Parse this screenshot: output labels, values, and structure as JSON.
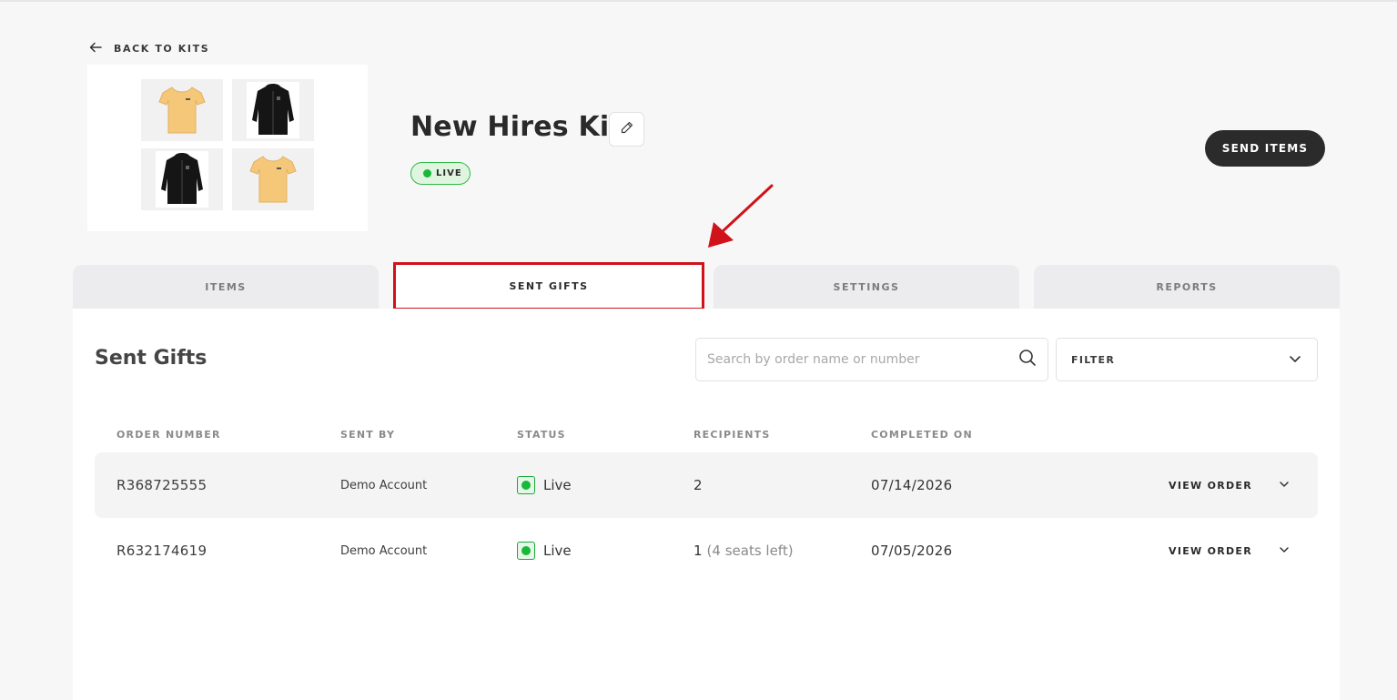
{
  "back_link": {
    "label": "BACK TO KITS",
    "icon": "arrow-left-icon"
  },
  "kit": {
    "title": "New Hires Kit",
    "status_badge": "LIVE",
    "images": [
      "yellow-tshirt",
      "black-zip-hoodie",
      "black-zip-hoodie",
      "yellow-tshirt"
    ]
  },
  "actions": {
    "send_items": "SEND ITEMS"
  },
  "tabs": [
    {
      "label": "ITEMS",
      "active": false
    },
    {
      "label": "SENT GIFTS",
      "active": true
    },
    {
      "label": "SETTINGS",
      "active": false
    },
    {
      "label": "REPORTS",
      "active": false
    }
  ],
  "sent_gifts": {
    "title": "Sent Gifts",
    "search_placeholder": "Search by order name or number",
    "filter_label": "FILTER",
    "columns": {
      "order_number": "ORDER NUMBER",
      "sent_by": "SENT BY",
      "status": "STATUS",
      "recipients": "RECIPIENTS",
      "completed_on": "COMPLETED ON"
    },
    "rows": [
      {
        "order_number": "R368725555",
        "sent_by": "Demo Account",
        "status": "Live",
        "recipients": "2",
        "recipients_extra": "",
        "completed_on": "07/14/2026",
        "action": "VIEW ORDER"
      },
      {
        "order_number": "R632174619",
        "sent_by": "Demo Account",
        "status": "Live",
        "recipients": "1",
        "recipients_extra": "(4 seats left)",
        "completed_on": "07/05/2026",
        "action": "VIEW ORDER"
      }
    ]
  },
  "colors": {
    "primary_dark": "#2b2b2b",
    "live_green": "#18b83a",
    "highlight_red": "#d0131a",
    "background": "#f7f7f7"
  }
}
